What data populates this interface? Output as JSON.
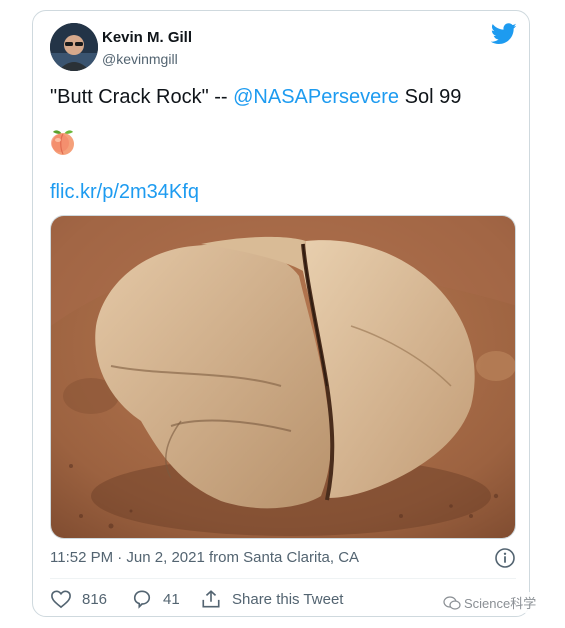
{
  "author": {
    "display_name": "Kevin M. Gill",
    "handle": "@kevinmgill"
  },
  "tweet": {
    "text_before": "\"Butt Crack Rock\" -- ",
    "mention": "@NASAPersevere",
    "text_after": " Sol 99",
    "emoji": "peach",
    "link": "flic.kr/p/2m34Kfq",
    "timestamp": "11:52 PM · Jun 2, 2021 from Santa Clarita, CA"
  },
  "actions": {
    "likes": "816",
    "replies": "41",
    "share_label": "Share this Tweet"
  },
  "watermark": {
    "text": "Science科学"
  },
  "icons": {
    "logo": "twitter-bird-icon",
    "info": "info-icon",
    "like": "heart-icon",
    "reply": "reply-bubble-icon",
    "share": "share-icon"
  },
  "colors": {
    "accent": "#1d9bf0",
    "text": "#0f1419",
    "muted": "#536471",
    "border": "#cfd9de"
  }
}
